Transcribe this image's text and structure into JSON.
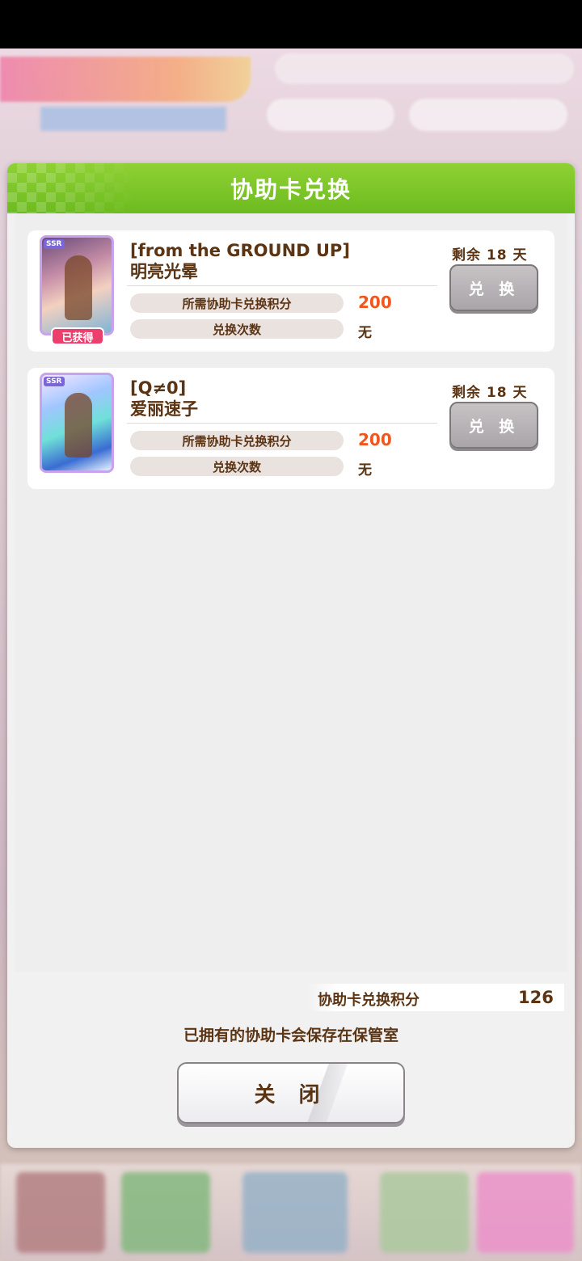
{
  "dialog": {
    "title": "协助卡兑换",
    "items": [
      {
        "title_line1": "[from the GROUND UP]",
        "title_line2": "明亮光晕",
        "remaining": "剩余 18 天",
        "exchange_label": "兑 换",
        "cost_label": "所需协助卡兑换积分",
        "cost_value": "200",
        "count_label": "兑换次数",
        "count_value": "无",
        "owned_badge": "已获得",
        "rarity": "SSR"
      },
      {
        "title_line1": "[Q≠0]",
        "title_line2": "爱丽速子",
        "remaining": "剩余 18 天",
        "exchange_label": "兑 换",
        "cost_label": "所需协助卡兑换积分",
        "cost_value": "200",
        "count_label": "兑换次数",
        "count_value": "无",
        "rarity": "SSR"
      }
    ],
    "points_label": "协助卡兑换积分",
    "points_value": "126",
    "note": "已拥有的协助卡会保存在保管室",
    "close_label": "关 闭"
  },
  "colors": {
    "header_green": "#7cc52a",
    "text_brown": "#5b3414",
    "accent_orange": "#f0561d",
    "owned_pink": "#ec3f6d"
  }
}
